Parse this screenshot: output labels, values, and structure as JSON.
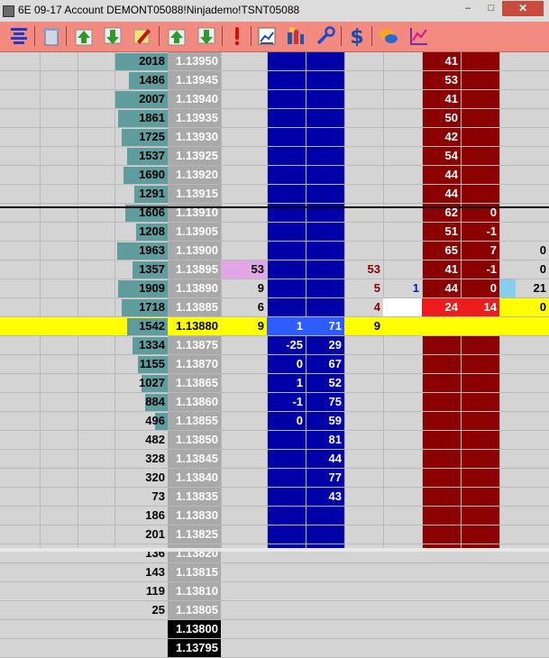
{
  "window": {
    "title": "6E 09-17  Account DEMONT05088!Ninjademo!TSNT05088",
    "minimize_label": "–",
    "maximize_label": "□",
    "close_label": "✕"
  },
  "toolbar": {
    "icons": [
      "center-ladder-icon",
      "recycle-bin-icon",
      "move-up-icon",
      "move-down-icon",
      "highlighter-icon",
      "scroll-up-icon",
      "scroll-down-icon",
      "alert-icon",
      "chart-book-icon",
      "column-options-icon",
      "wrench-icon",
      "dollar-icon",
      "chat-icon",
      "chart-icon"
    ]
  },
  "colors": {
    "background": "#d4d4d4",
    "volume_bar": "#5f9c9e",
    "price_cell": "#a9a9a9",
    "blue_column": "#0000a8",
    "red_column": "#8b0000",
    "highlight": "#ffff00",
    "bid_size": "#e2a6e6",
    "last_price_cell": "#000000",
    "ask_volume_cell": "#87ceeb"
  },
  "ladder": [
    {
      "vol": "2018",
      "price": "1.13950",
      "c7": "",
      "c8": "",
      "c9": "",
      "c10": "",
      "c11": "41",
      "c12": "",
      "c13": "",
      "bar": 0.3
    },
    {
      "vol": "1486",
      "price": "1.13945",
      "c7": "",
      "c8": "",
      "c9": "",
      "c10": "",
      "c11": "53",
      "c12": "",
      "c13": "",
      "bar": 0.22
    },
    {
      "vol": "2007",
      "price": "1.13940",
      "c7": "",
      "c8": "",
      "c9": "",
      "c10": "",
      "c11": "41",
      "c12": "",
      "c13": "",
      "bar": 0.3
    },
    {
      "vol": "1861",
      "price": "1.13935",
      "c7": "",
      "c8": "",
      "c9": "",
      "c10": "",
      "c11": "50",
      "c12": "",
      "c13": "",
      "bar": 0.28
    },
    {
      "vol": "1725",
      "price": "1.13930",
      "c7": "",
      "c8": "",
      "c9": "",
      "c10": "",
      "c11": "42",
      "c12": "",
      "c13": "",
      "bar": 0.26
    },
    {
      "vol": "1537",
      "price": "1.13925",
      "c7": "",
      "c8": "",
      "c9": "",
      "c10": "",
      "c11": "54",
      "c12": "",
      "c13": "",
      "bar": 0.23
    },
    {
      "vol": "1690",
      "price": "1.13920",
      "c7": "",
      "c8": "",
      "c9": "",
      "c10": "",
      "c11": "44",
      "c12": "",
      "c13": "",
      "bar": 0.25
    },
    {
      "vol": "1291",
      "price": "1.13915",
      "c7": "",
      "c8": "",
      "c9": "",
      "c10": "",
      "c11": "44",
      "c12": "",
      "c13": "",
      "bar": 0.19
    },
    {
      "vol": "1606",
      "price": "1.13910",
      "c7": "",
      "c8": "",
      "c9": "",
      "c10": "",
      "c11": "62",
      "c12": "0",
      "c13": "",
      "bar": 0.24
    },
    {
      "vol": "1208",
      "price": "1.13905",
      "c7": "",
      "c8": "",
      "c9": "",
      "c10": "",
      "c11": "51",
      "c12": "-1",
      "c13": "",
      "bar": 0.18
    },
    {
      "vol": "1963",
      "price": "1.13900",
      "c7": "",
      "c8": "",
      "c9": "",
      "c10": "",
      "c11": "65",
      "c12": "7",
      "c13": "0",
      "bar": 0.29
    },
    {
      "vol": "1357",
      "price": "1.13895",
      "c4": "53",
      "c7": "",
      "c8": "53",
      "c9": "",
      "c10": "",
      "c11": "41",
      "c12": "-1",
      "c13": "0",
      "bar": 0.2
    },
    {
      "vol": "1909",
      "price": "1.13890",
      "c4": "9",
      "c7": "",
      "c8": "5",
      "c9": "1",
      "c10": "",
      "c11": "44",
      "c12": "0",
      "c13": "21",
      "bar": 0.28
    },
    {
      "vol": "1718",
      "price": "1.13885",
      "c4": "6",
      "c7": "",
      "c8": "4",
      "c9": "",
      "c10": "",
      "c11": "24",
      "c12": "14",
      "c13": "0",
      "bar": 0.26
    },
    {
      "vol": "1542",
      "price": "1.13880",
      "c4": "9",
      "c5": "1",
      "c6": "71",
      "c7": "9",
      "c8": "",
      "c9": "",
      "c10": "",
      "c11": "",
      "c12": "",
      "c13": "",
      "bar": 0.23
    },
    {
      "vol": "1334",
      "price": "1.13875",
      "c5": "-25",
      "c6": "29",
      "bar": 0.2
    },
    {
      "vol": "1155",
      "price": "1.13870",
      "c5": "0",
      "c6": "67",
      "bar": 0.17
    },
    {
      "vol": "1027",
      "price": "1.13865",
      "c5": "1",
      "c6": "52",
      "bar": 0.15
    },
    {
      "vol": "884",
      "price": "1.13860",
      "c5": "-1",
      "c6": "75",
      "bar": 0.13
    },
    {
      "vol": "496",
      "price": "1.13855",
      "c5": "0",
      "c6": "59",
      "bar": 0.07
    },
    {
      "vol": "482",
      "price": "1.13850",
      "c6": "81",
      "bar": 0.0
    },
    {
      "vol": "328",
      "price": "1.13845",
      "c6": "44",
      "bar": 0.0
    },
    {
      "vol": "320",
      "price": "1.13840",
      "c6": "77",
      "bar": 0.0
    },
    {
      "vol": "73",
      "price": "1.13835",
      "c6": "43",
      "bar": 0.0
    },
    {
      "vol": "186",
      "price": "1.13830",
      "bar": 0.0
    },
    {
      "vol": "201",
      "price": "1.13825",
      "bar": 0.0
    },
    {
      "vol": "136",
      "price": "1.13820",
      "bar": 0.0
    },
    {
      "vol": "143",
      "price": "1.13815",
      "bar": 0.0
    },
    {
      "vol": "119",
      "price": "1.13810",
      "bar": 0.0
    },
    {
      "vol": "25",
      "price": "1.13805",
      "bar": 0.0
    },
    {
      "vol": "",
      "price": "1.13800",
      "bar": 0.0
    },
    {
      "vol": "",
      "price": "1.13795",
      "bar": 0.0
    }
  ]
}
